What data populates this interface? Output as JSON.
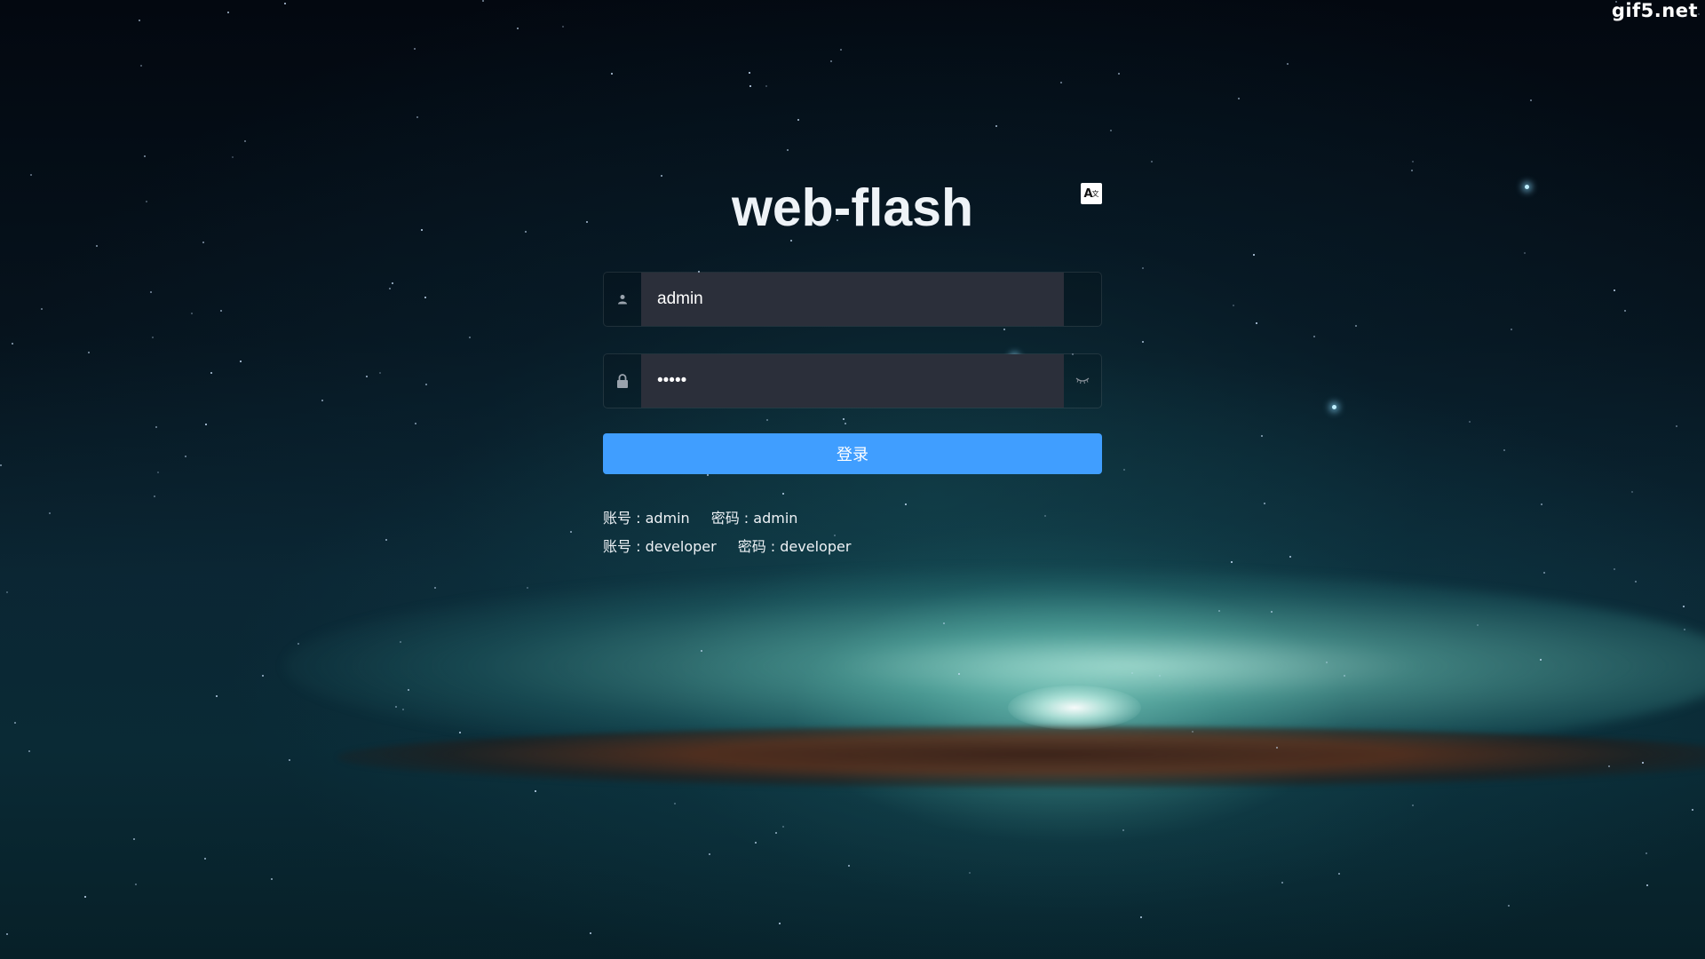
{
  "watermark": "gif5.net",
  "login": {
    "title": "web-flash",
    "lang_icon": "translate-icon",
    "username": {
      "icon": "user-icon",
      "value": "admin"
    },
    "password": {
      "icon": "lock-icon",
      "value": "admin",
      "toggle_icon": "eye-closed-icon"
    },
    "submit_label": "登录",
    "tips": [
      {
        "account": "账号 : admin",
        "password": "密码 : admin"
      },
      {
        "account": "账号 : developer",
        "password": "密码 : developer"
      }
    ]
  },
  "colors": {
    "primary_button": "#409eff",
    "input_bg": "#2b2f3a",
    "title_text": "#eef3f7"
  }
}
